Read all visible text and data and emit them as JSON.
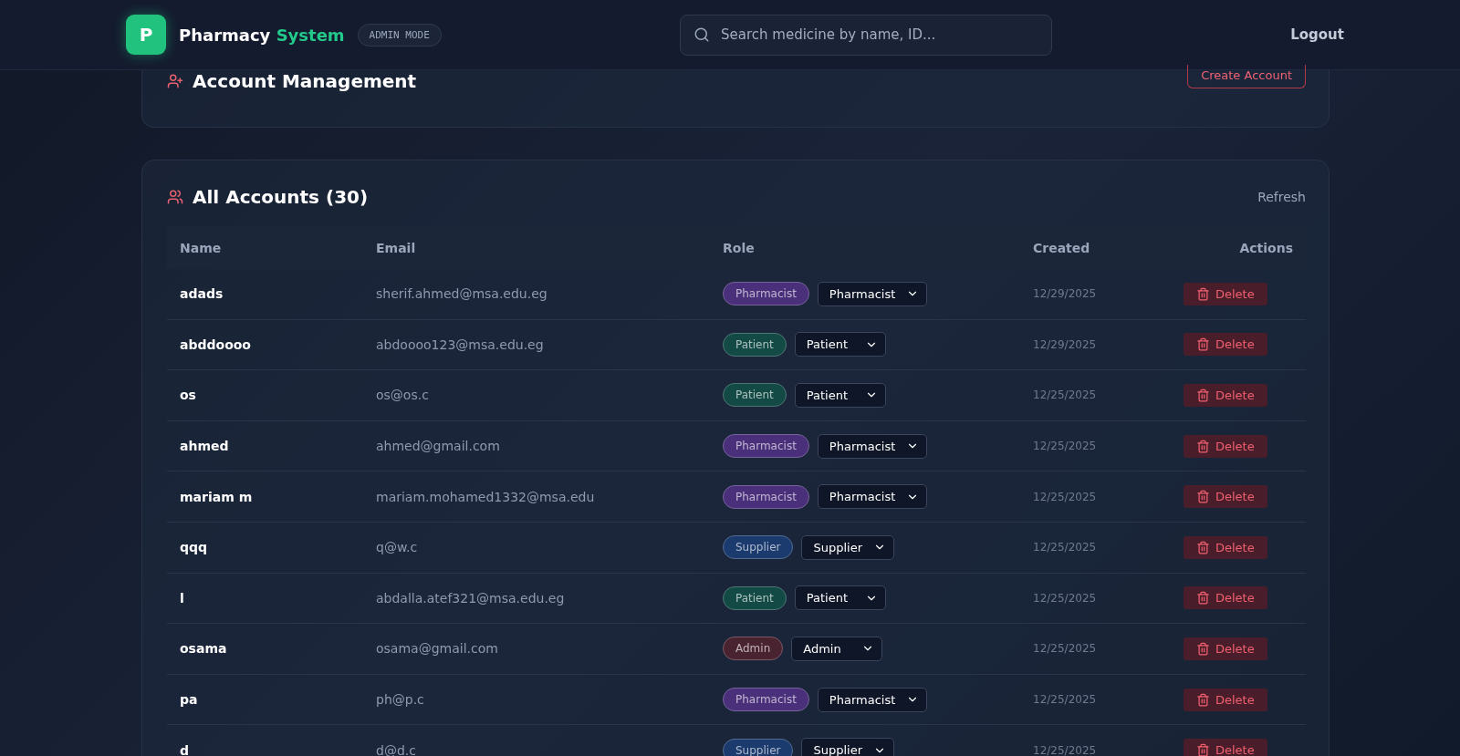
{
  "header": {
    "logo_letter": "P",
    "brand": "Pharmacy",
    "brand_accent": "System",
    "mode_badge": "ADMIN MODE",
    "search": {
      "placeholder": "Search medicine by name, ID..."
    },
    "logout": "Logout"
  },
  "management": {
    "title": "Account Management",
    "create_button": "Create Account"
  },
  "accounts": {
    "title": "All Accounts (30)",
    "refresh": "Refresh",
    "columns": [
      "Name",
      "Email",
      "Role",
      "Created",
      "Actions"
    ],
    "rows": [
      {
        "name": "adads",
        "email": "sherif.ahmed@msa.edu.eg",
        "color": "#4a2f7a",
        "role_badge": "Pharmacist",
        "role_select": "Pharmacist",
        "created": "12/29/2025",
        "action": "Delete"
      },
      {
        "name": "abddoooo",
        "email": "abdoooo123@msa.edu.eg",
        "color": "#134a45",
        "role_badge": "Patient",
        "role_select": "Patient",
        "created": "12/29/2025",
        "action": "Delete"
      },
      {
        "name": "os",
        "email": "os@os.c",
        "color": "#134a45",
        "role_badge": "Patient",
        "role_select": "Patient",
        "created": "12/25/2025",
        "action": "Delete"
      },
      {
        "name": "ahmed",
        "email": "ahmed@gmail.com",
        "color": "#4a2f7a",
        "role_badge": "Pharmacist",
        "role_select": "Pharmacist",
        "created": "12/25/2025",
        "action": "Delete"
      },
      {
        "name": "mariam m",
        "email": "mariam.mohamed1332@msa.edu",
        "color": "#4a2f7a",
        "role_badge": "Pharmacist",
        "role_select": "Pharmacist",
        "created": "12/25/2025",
        "action": "Delete"
      },
      {
        "name": "qqq",
        "email": "q@w.c",
        "color": "#1b3a6e",
        "role_badge": "Supplier",
        "role_select": "Supplier",
        "created": "12/25/2025",
        "action": "Delete"
      },
      {
        "name": "l",
        "email": "abdalla.atef321@msa.edu.eg",
        "color": "#134a45",
        "role_badge": "Patient",
        "role_select": "Patient",
        "created": "12/25/2025",
        "action": "Delete"
      },
      {
        "name": "osama",
        "email": "osama@gmail.com",
        "color": "#4a2331",
        "role_badge": "Admin",
        "role_select": "Admin",
        "created": "12/25/2025",
        "action": "Delete"
      },
      {
        "name": "pa",
        "email": "ph@p.c",
        "color": "#4a2f7a",
        "role_badge": "Pharmacist",
        "role_select": "Pharmacist",
        "created": "12/25/2025",
        "action": "Delete"
      },
      {
        "name": "d",
        "email": "d@d.c",
        "color": "#1b3a6e",
        "role_badge": "Supplier",
        "role_select": "Supplier",
        "created": "12/25/2025",
        "action": "Delete"
      }
    ]
  }
}
